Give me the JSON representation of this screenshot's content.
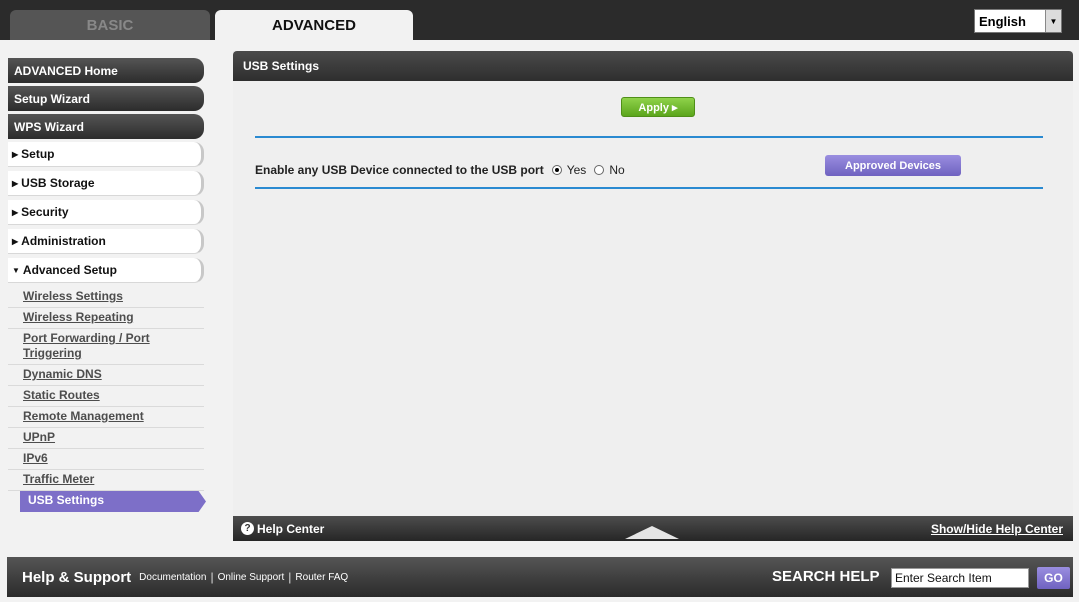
{
  "tabs": {
    "basic": "BASIC",
    "advanced": "ADVANCED"
  },
  "language": {
    "selected": "English"
  },
  "sidebar": {
    "dark_items": [
      "ADVANCED Home",
      "Setup Wizard",
      "WPS Wizard"
    ],
    "sections": [
      "Setup",
      "USB Storage",
      "Security",
      "Administration",
      "Advanced Setup"
    ],
    "sub_items": [
      "Wireless Settings",
      "Wireless Repeating",
      "Port Forwarding / Port Triggering",
      "Dynamic DNS",
      "Static Routes",
      "Remote Management",
      "UPnP",
      "IPv6",
      "Traffic Meter",
      "USB Settings"
    ],
    "active_sub_item": "USB Settings"
  },
  "panel": {
    "title": "USB Settings",
    "apply_label": "Apply ▸",
    "usb_label": "Enable any USB Device connected to the USB port",
    "radio_yes": "Yes",
    "radio_no": "No",
    "selected": "Yes",
    "approved_label": "Approved Devices"
  },
  "help_bar": {
    "help_center": "Help Center",
    "show_hide": "Show/Hide Help Center"
  },
  "footer": {
    "title": "Help & Support",
    "links": [
      "Documentation",
      "Online Support",
      "Router FAQ"
    ],
    "search_label": "SEARCH HELP",
    "search_value": "Enter Search Item",
    "go_label": "GO"
  },
  "colors": {
    "accent_purple": "#7d6fc8",
    "apply_green": "#6fba2c",
    "rule_blue": "#2a8ad1"
  }
}
